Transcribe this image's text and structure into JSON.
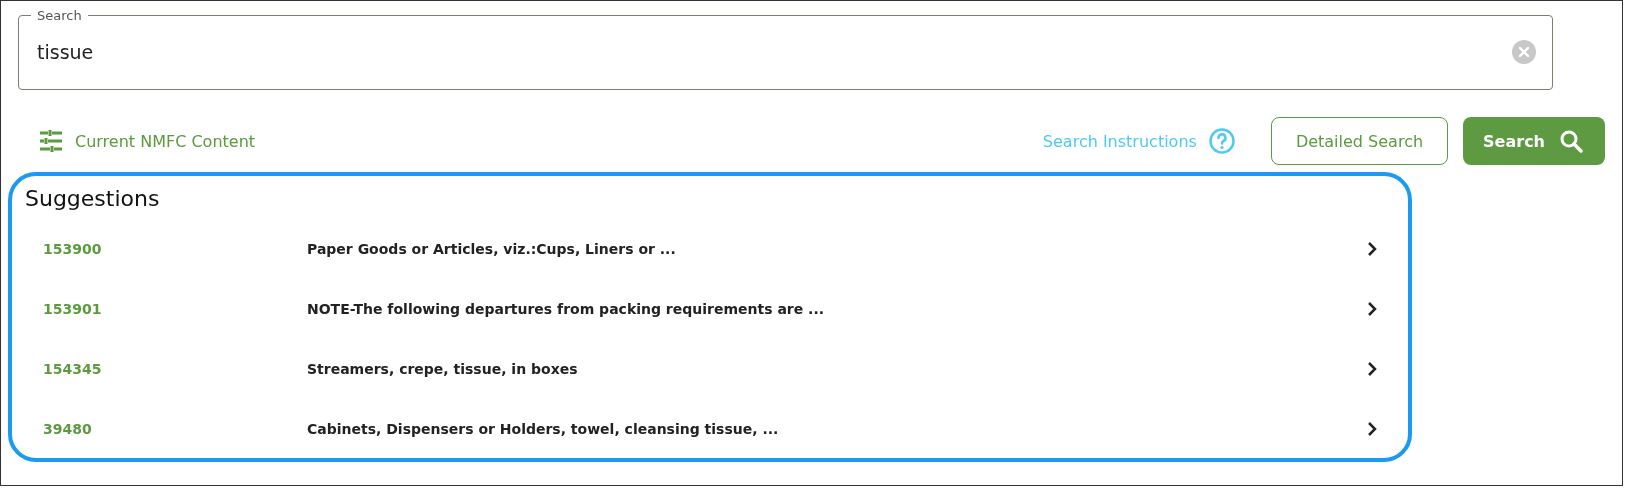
{
  "search": {
    "label": "Search",
    "value": "tissue"
  },
  "toolbar": {
    "content_link": "Current NMFC Content",
    "instructions_link": "Search Instructions",
    "buttons": [
      "Detailed Search",
      "Search"
    ]
  },
  "suggestions": {
    "title": "Suggestions",
    "items": [
      {
        "code": "153900",
        "description": "Paper Goods or Articles, viz.:Cups, Liners or ..."
      },
      {
        "code": "153901",
        "description": "NOTE-The following departures from packing requirements are ..."
      },
      {
        "code": "154345",
        "description": "Streamers, crepe, tissue, in boxes"
      },
      {
        "code": "39480",
        "description": "Cabinets, Dispensers or Holders, towel, cleansing tissue, ..."
      }
    ]
  }
}
